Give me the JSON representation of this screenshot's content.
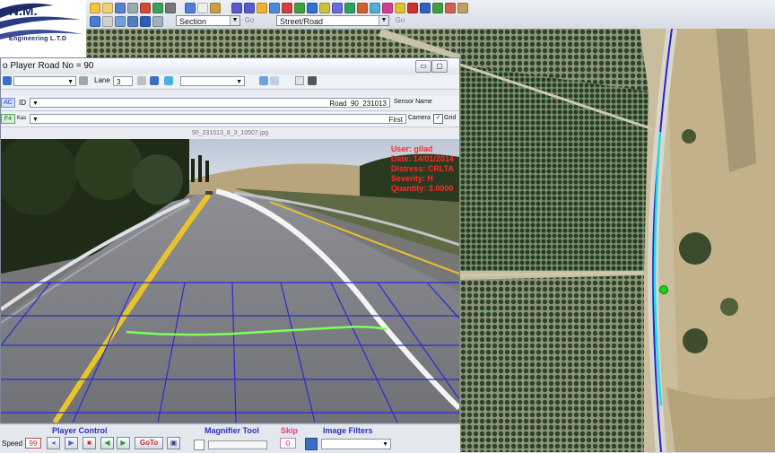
{
  "app": {
    "logo_text": "N.M.",
    "logo_subtext": "Engineering L.T.D"
  },
  "toolbar": {
    "section_combo": "Section",
    "goto_label": "Go",
    "street_combo": "Street/Road",
    "go_label": "Go"
  },
  "player": {
    "title": "o Player    Road No = 90",
    "lane_label": "Lane",
    "lane_value": "3",
    "id_label": "ID",
    "id_value": "Road_90_231013",
    "sensor_label": "Sensor Name",
    "first_label": "First",
    "camera_label": "Camera",
    "grid_label": "Grid",
    "small_btn1": "AC",
    "small_btn2": "F4",
    "kas_label": "Kas",
    "filename": "90_231013_8_3_10507.jpg",
    "overlay": {
      "user": "User: gilad",
      "date": "Date: 14/01/2014",
      "distress": "Distress: CRLTA",
      "severity": "Severity: H",
      "quantity": "Quantity: 3.0000"
    }
  },
  "bottom": {
    "player_control_label": "Player Control",
    "speed_label": "Speed",
    "speed_value": "99",
    "goto_label": "GoTo",
    "magnifier_label": "Magnifier Tool",
    "skip_label": "Skip",
    "skip_value": "0",
    "image_filters_label": "Image Filters"
  },
  "colors": {
    "road_trace": "#2424c8",
    "road_trace_selected": "#1ee0e8",
    "grid": "#2a2ad6",
    "crack_line": "#7dff5a",
    "overlay_text": "#ff2a2a",
    "label_blue": "#2b2fb8"
  },
  "map": {
    "marker_color": "#19d619"
  }
}
